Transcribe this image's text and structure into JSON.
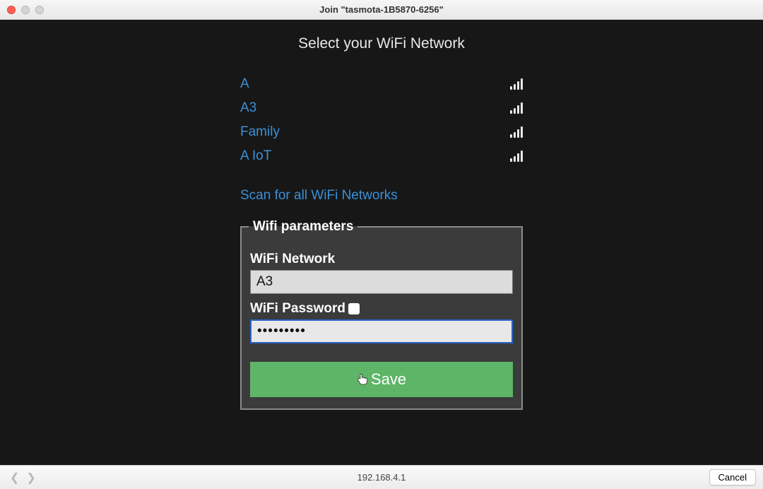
{
  "window": {
    "title": "Join \"tasmota-1B5870-6256\""
  },
  "page": {
    "heading": "Select your WiFi Network",
    "scan_link": "Scan for all WiFi Networks"
  },
  "networks": [
    {
      "name": "A"
    },
    {
      "name": "A3"
    },
    {
      "name": "Family"
    },
    {
      "name": "A IoT"
    }
  ],
  "form": {
    "legend": "Wifi parameters",
    "network_label": "WiFi Network",
    "network_value": "A3",
    "password_label": "WiFi Password",
    "password_value": "•••••••••",
    "save_label": "Save"
  },
  "footer": {
    "address": "192.168.4.1",
    "cancel_label": "Cancel"
  }
}
